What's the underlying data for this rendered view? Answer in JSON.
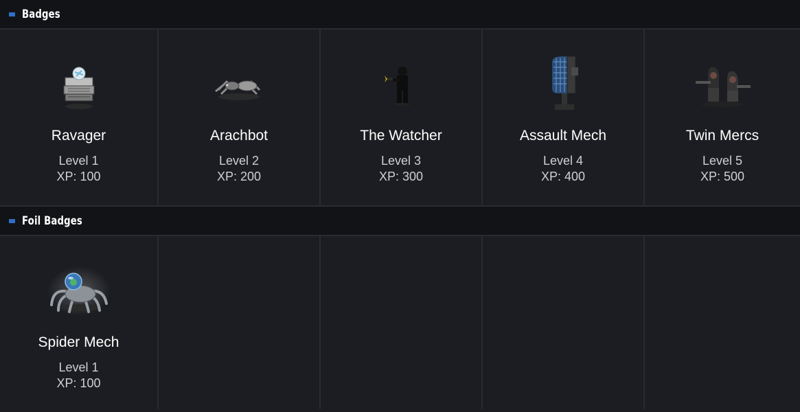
{
  "sections": [
    {
      "title": "Badges",
      "items": [
        {
          "name": "Ravager",
          "level": "Level 1",
          "xp": "XP: 100",
          "icon": "ravager-icon"
        },
        {
          "name": "Arachbot",
          "level": "Level 2",
          "xp": "XP: 200",
          "icon": "arachbot-icon"
        },
        {
          "name": "The Watcher",
          "level": "Level 3",
          "xp": "XP: 300",
          "icon": "watcher-icon"
        },
        {
          "name": "Assault Mech",
          "level": "Level 4",
          "xp": "XP: 400",
          "icon": "assault-mech-icon"
        },
        {
          "name": "Twin Mercs",
          "level": "Level 5",
          "xp": "XP: 500",
          "icon": "twin-mercs-icon"
        }
      ]
    },
    {
      "title": "Foil Badges",
      "items": [
        {
          "name": "Spider Mech",
          "level": "Level 1",
          "xp": "XP: 100",
          "icon": "spider-mech-icon"
        }
      ]
    }
  ],
  "colors": {
    "background": "#1c1d22",
    "header_background": "#121317",
    "accent": "#2f6fc4",
    "divider": "#2a2b30"
  }
}
